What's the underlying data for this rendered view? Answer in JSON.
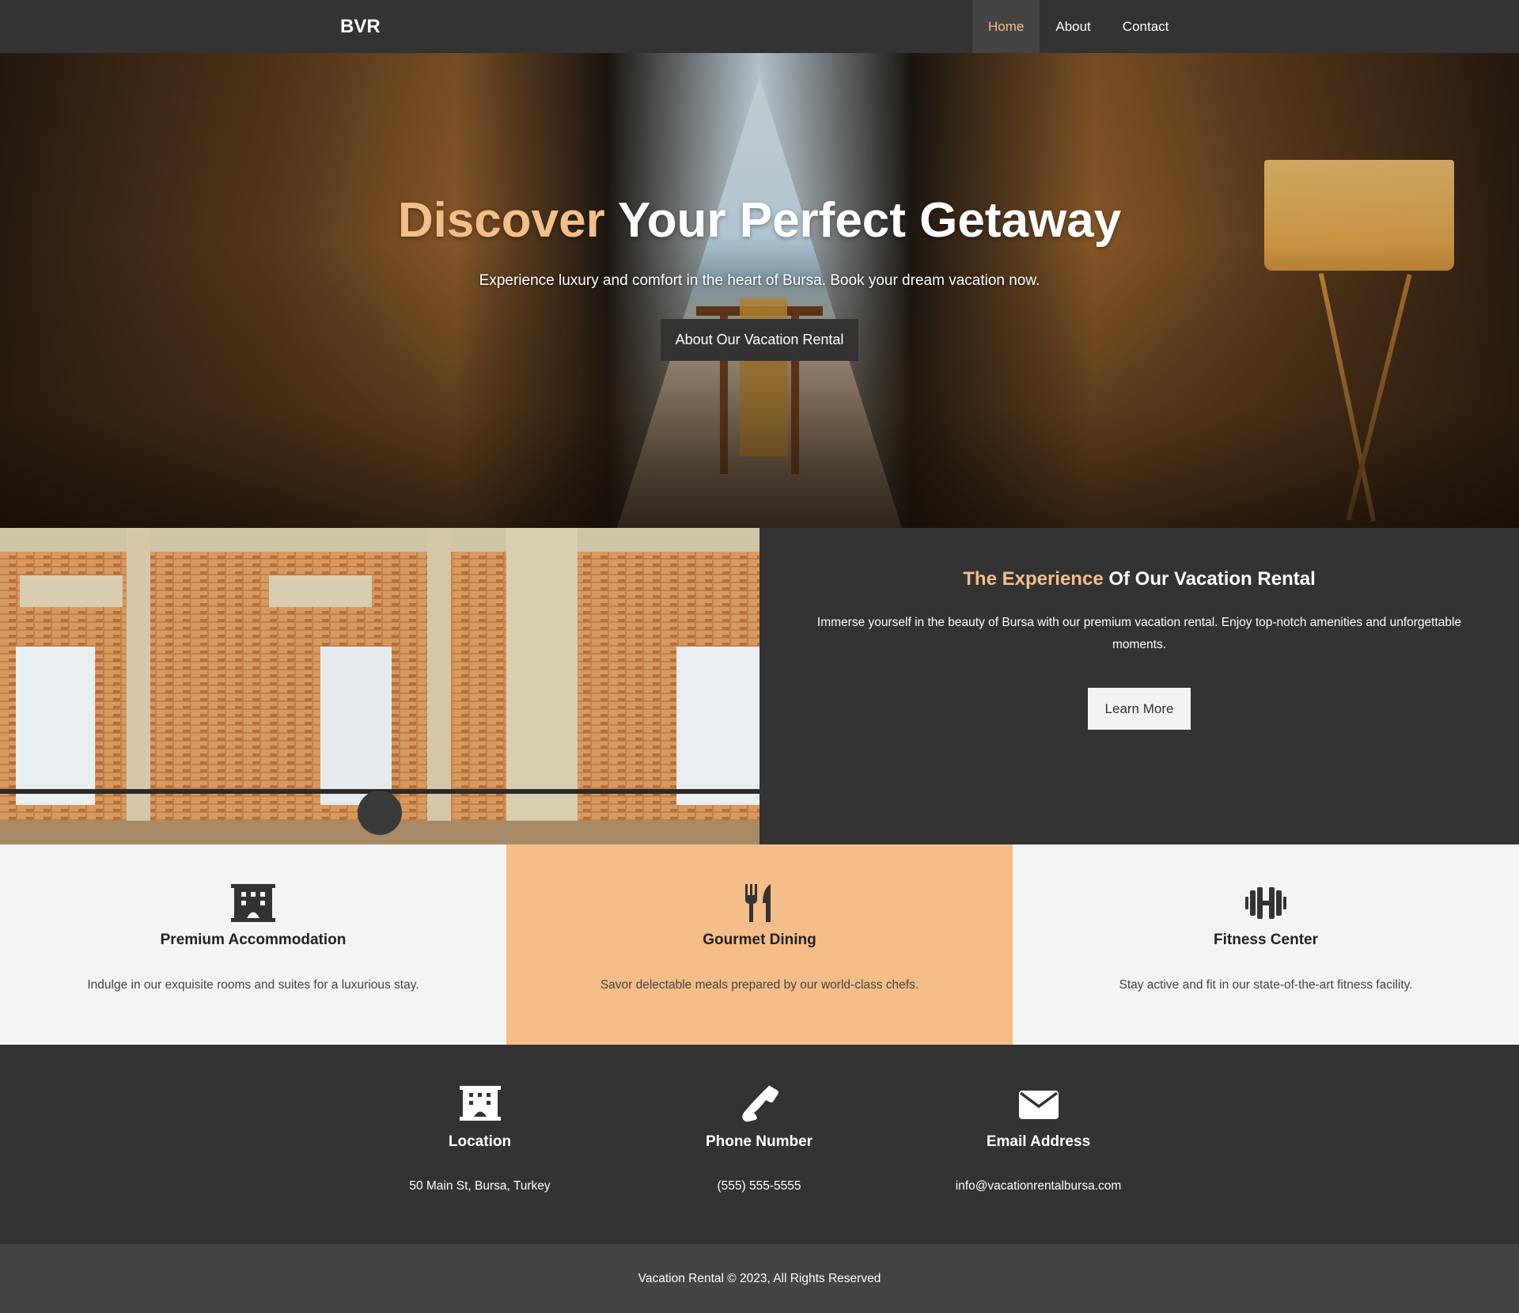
{
  "nav": {
    "brand": "BVR",
    "links": [
      {
        "label": "Home",
        "active": true
      },
      {
        "label": "About",
        "active": false
      },
      {
        "label": "Contact",
        "active": false
      }
    ]
  },
  "hero": {
    "title_accent": "Discover",
    "title_rest": "Your Perfect Getaway",
    "subtitle": "Experience luxury and comfort in the heart of Bursa. Book your dream vacation now.",
    "button_label": "About Our Vacation Rental"
  },
  "about": {
    "title_accent": "The Experience",
    "title_rest": "Of Our Vacation Rental",
    "description": "Immerse yourself in the beauty of Bursa with our premium vacation rental. Enjoy top-notch amenities and unforgettable moments.",
    "button_label": "Learn More"
  },
  "features": [
    {
      "icon": "building-icon",
      "title": "Premium Accommodation",
      "text": "Indulge in our exquisite rooms and suites for a luxurious stay."
    },
    {
      "icon": "utensils-icon",
      "title": "Gourmet Dining",
      "text": "Savor delectable meals prepared by our world-class chefs."
    },
    {
      "icon": "dumbbell-icon",
      "title": "Fitness Center",
      "text": "Stay active and fit in our state-of-the-art fitness facility."
    }
  ],
  "contact": [
    {
      "icon": "building-icon",
      "title": "Location",
      "text": "50 Main St, Bursa, Turkey"
    },
    {
      "icon": "phone-icon",
      "title": "Phone Number",
      "text": "(555) 555-5555"
    },
    {
      "icon": "envelope-icon",
      "title": "Email Address",
      "text": "info@vacationrentalbursa.com"
    }
  ],
  "footer": {
    "text": "Vacation Rental © 2023, All Rights Reserved"
  },
  "colors": {
    "accent": "#f5bd88",
    "dark": "#333333",
    "footer": "#444444",
    "light": "#f4f4f4"
  }
}
